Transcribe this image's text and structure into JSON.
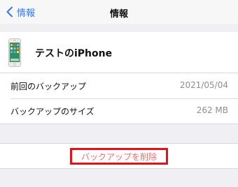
{
  "nav": {
    "back_label": "情報",
    "title": "情報"
  },
  "device": {
    "name": "テストのiPhone"
  },
  "info_rows": [
    {
      "label": "前回のバックアップ",
      "value": "2021/05/04"
    },
    {
      "label": "バックアップのサイズ",
      "value": "262 MB"
    }
  ],
  "actions": {
    "delete_label": "バックアップを削除"
  },
  "colors": {
    "accent": "#3478f6",
    "destructive_text": "#ff6a6a",
    "highlight_box": "#e0141a",
    "background": "#efeff4"
  },
  "icons": {
    "back": "chevron-left-icon",
    "device": "iphone-icon"
  }
}
